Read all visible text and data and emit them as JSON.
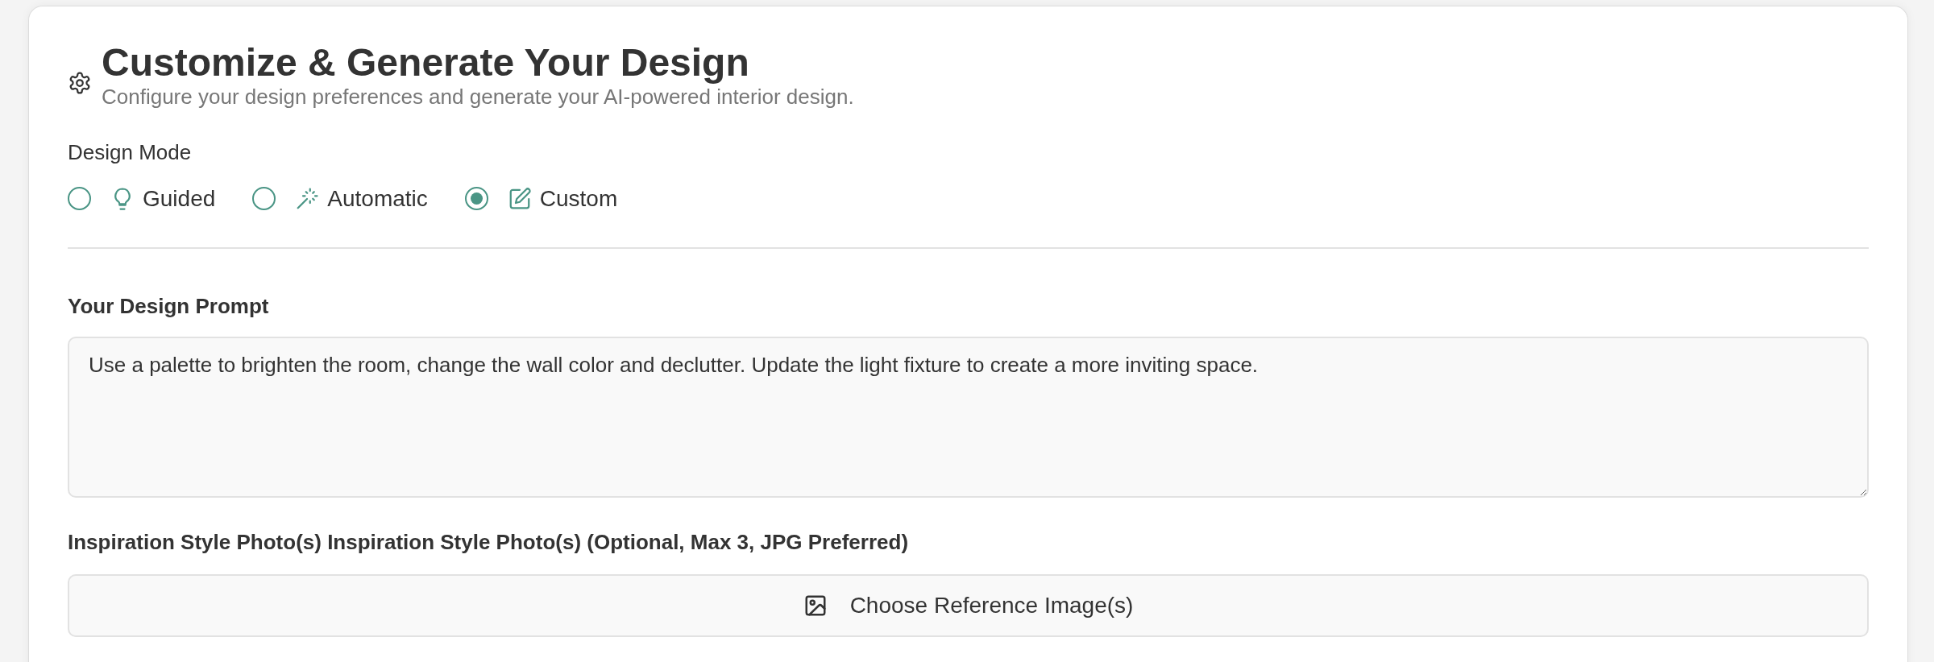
{
  "header": {
    "title": "Customize & Generate Your Design",
    "subtitle": "Configure your design preferences and generate your AI-powered interior design."
  },
  "design_mode": {
    "label": "Design Mode",
    "options": [
      {
        "label": "Guided",
        "kind": "bulb",
        "selected": false
      },
      {
        "label": "Automatic",
        "kind": "wand",
        "selected": false
      },
      {
        "label": "Custom",
        "kind": "edit",
        "selected": true
      }
    ]
  },
  "prompt": {
    "label": "Your Design Prompt",
    "value": "Use a palette to brighten the room, change the wall color and declutter. Update the light fixture to create a more inviting space."
  },
  "inspiration": {
    "label": "Inspiration Style Photo(s) Inspiration Style Photo(s) (Optional, Max 3, JPG Preferred)",
    "button": "Choose Reference Image(s)"
  }
}
